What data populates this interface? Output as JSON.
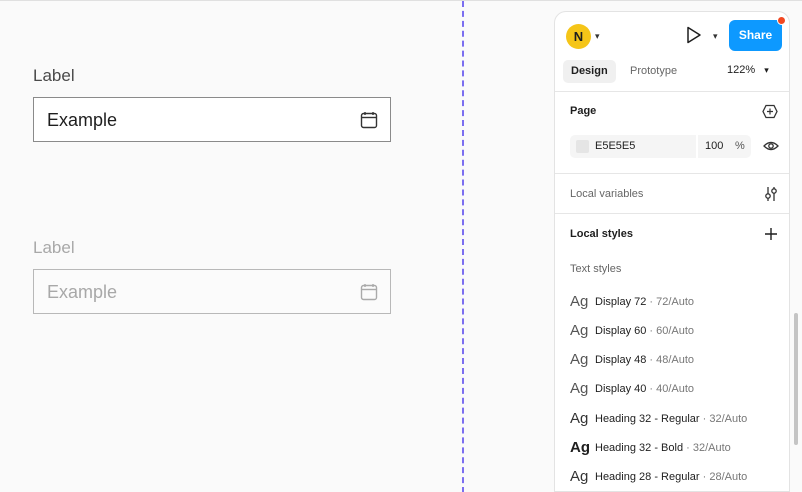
{
  "canvas": {
    "field1": {
      "label": "Label",
      "value": "Example",
      "icon": "calendar-icon"
    },
    "field2": {
      "label": "Label",
      "value": "Example",
      "icon": "calendar-icon"
    }
  },
  "panel": {
    "header": {
      "avatar": "N",
      "share_label": "Share",
      "play_icon": "play-icon"
    },
    "tabs": [
      {
        "label": "Design"
      },
      {
        "label": "Prototype"
      }
    ],
    "zoom": "122%",
    "page": {
      "title": "Page",
      "fill_hex": "E5E5E5",
      "opacity": "100",
      "percent": "%",
      "swatch_color": "#E5E5E5"
    },
    "local_variables": {
      "title": "Local variables"
    },
    "local_styles": {
      "title": "Local styles",
      "subtitle": "Text styles"
    },
    "text_styles": [
      {
        "ag": "Ag",
        "name": "Display 72",
        "spec": " · 72/Auto"
      },
      {
        "ag": "Ag",
        "name": "Display 60",
        "spec": " · 60/Auto"
      },
      {
        "ag": "Ag",
        "name": "Display 48",
        "spec": " · 48/Auto"
      },
      {
        "ag": "Ag",
        "name": "Display 40",
        "spec": " · 40/Auto"
      },
      {
        "ag": "Ag",
        "name": "Heading 32 - Regular",
        "spec": " · 32/Auto"
      },
      {
        "ag": "Ag",
        "name": "Heading 32 - Bold",
        "spec": " · 32/Auto"
      },
      {
        "ag": "Ag",
        "name": "Heading 28 - Regular",
        "spec": " · 28/Auto"
      }
    ]
  },
  "colors": {
    "accent": "#0d99ff",
    "guide": "#7b6ef0",
    "avatar": "#f5c518",
    "notification": "#f24822"
  }
}
